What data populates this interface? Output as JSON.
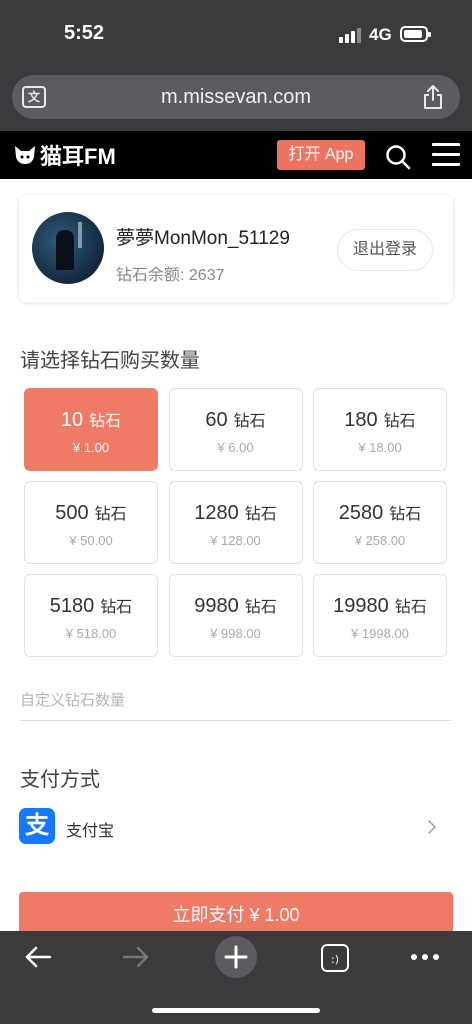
{
  "status_bar": {
    "time": "5:52",
    "network": "4G"
  },
  "browser": {
    "url": "m.missevan.com"
  },
  "site_header": {
    "logo_text": "猫耳FM",
    "open_app_label": "打开 App"
  },
  "user": {
    "name": "夢夢MonMon_51129",
    "balance": "钻石余额: 2637",
    "logout_label": "退出登录"
  },
  "purchase": {
    "title": "请选择钻石购买数量",
    "unit": "钻石",
    "options": [
      {
        "amount": "10",
        "price": "¥ 1.00",
        "selected": true
      },
      {
        "amount": "60",
        "price": "¥ 6.00",
        "selected": false
      },
      {
        "amount": "180",
        "price": "¥ 18.00",
        "selected": false
      },
      {
        "amount": "500",
        "price": "¥ 50.00",
        "selected": false
      },
      {
        "amount": "1280",
        "price": "¥ 128.00",
        "selected": false
      },
      {
        "amount": "2580",
        "price": "¥ 258.00",
        "selected": false
      },
      {
        "amount": "5180",
        "price": "¥ 518.00",
        "selected": false
      },
      {
        "amount": "9980",
        "price": "¥ 998.00",
        "selected": false
      },
      {
        "amount": "19980",
        "price": "¥ 1998.00",
        "selected": false
      }
    ],
    "custom_placeholder": "自定义钻石数量"
  },
  "payment": {
    "title": "支付方式",
    "method_label": "支付宝",
    "method_icon": "支",
    "pay_button_label": "立即支付 ¥ 1.00"
  },
  "colors": {
    "accent": "#ef7a66",
    "alipay": "#1677ff",
    "chrome": "#3a3b3d"
  }
}
